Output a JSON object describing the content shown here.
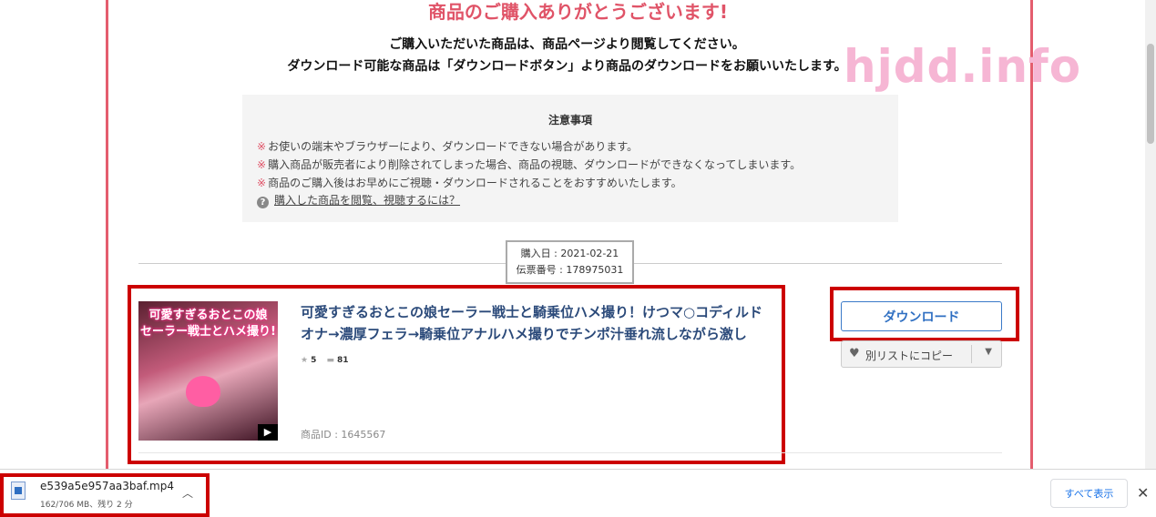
{
  "header": {
    "thanks": "商品のご購入ありがとうございます!",
    "instruction_1": "ご購入いただいた商品は、商品ページより閲覧してください。",
    "instruction_2": "ダウンロード可能な商品は「ダウンロードボタン」より商品のダウンロードをお願いいたします。",
    "watermark": "hjdd.info"
  },
  "notes": {
    "title": "注意事項",
    "mark": "※",
    "items": [
      "お使いの端末やブラウザーにより、ダウンロードできない場合があります。",
      "購入商品が販売者により削除されてしまった場合、商品の視聴、ダウンロードができなくなってしまいます。",
      "商品のご購入後はお早めにご視聴・ダウンロードされることをおすすめいたします。"
    ],
    "help_icon": "?",
    "help_link": "購入した商品を閲覧、視聴するには？"
  },
  "purchase": {
    "date": "購入日 : 2021-02-21",
    "slip": "伝票番号 : 178975031"
  },
  "product": {
    "thumb_line_1": "可愛すぎるおとこの娘",
    "thumb_line_2": "セーラー戦士とハメ撮り!",
    "title": "可愛すぎるおとこの娘セーラー戦士と騎乗位ハメ撮り！けつマ○コディルドオナ→濃厚フェラ→騎乗位アナルハメ撮りでチンポ汁垂れ流しながら激し",
    "rating": "5",
    "comments": "81",
    "id": "商品ID : 1645567",
    "download_label": "ダウンロード",
    "copy_label": "別リストにコピー"
  },
  "download_bar": {
    "filename": "e539a5e957aa3baf.mp4",
    "status": "162/706 MB、残り 2 分",
    "show_all": "すべて表示",
    "close": "✕"
  },
  "colors": {
    "accent_pink": "#e05468",
    "highlight_red": "#cc0000",
    "link_blue": "#2f6fc2"
  }
}
